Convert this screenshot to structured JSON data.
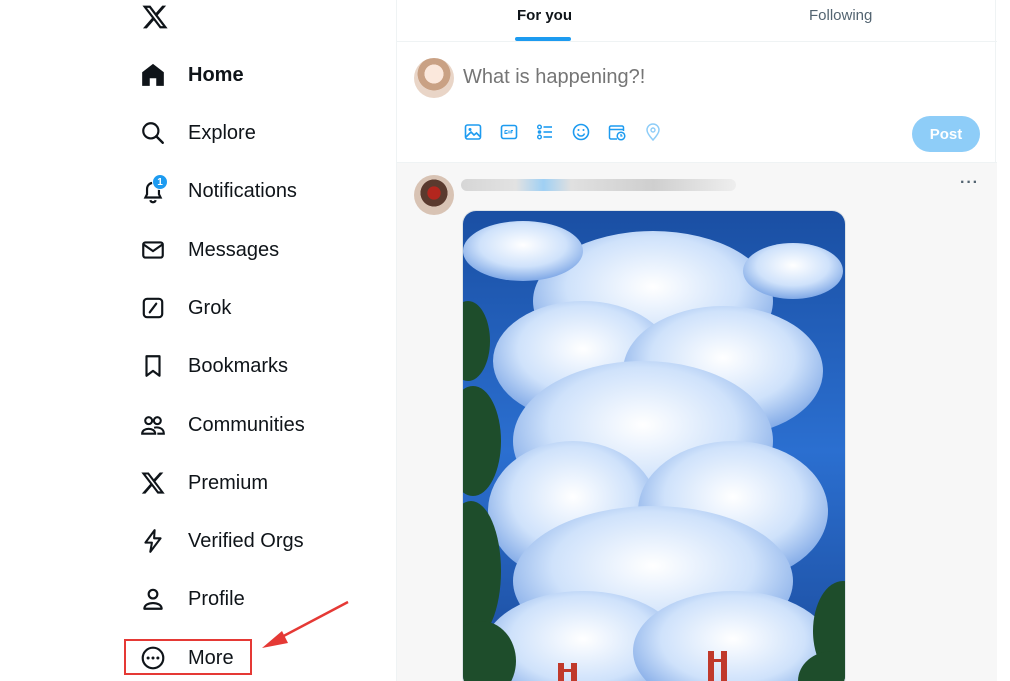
{
  "sidebar": {
    "logo": "x-logo-icon",
    "items": [
      {
        "label": "Home",
        "icon": "home-icon",
        "active": true
      },
      {
        "label": "Explore",
        "icon": "search-icon"
      },
      {
        "label": "Notifications",
        "icon": "bell-icon",
        "badge": "1"
      },
      {
        "label": "Messages",
        "icon": "envelope-icon"
      },
      {
        "label": "Grok",
        "icon": "grok-icon"
      },
      {
        "label": "Bookmarks",
        "icon": "bookmark-icon"
      },
      {
        "label": "Communities",
        "icon": "people-icon"
      },
      {
        "label": "Premium",
        "icon": "x-premium-icon"
      },
      {
        "label": "Verified Orgs",
        "icon": "lightning-icon"
      },
      {
        "label": "Profile",
        "icon": "person-icon"
      },
      {
        "label": "More",
        "icon": "more-circle-icon"
      }
    ]
  },
  "tabs": [
    {
      "label": "For you",
      "active": true
    },
    {
      "label": "Following",
      "active": false
    }
  ],
  "composer": {
    "placeholder": "What is happening?!",
    "post_label": "Post",
    "tools": [
      "image-icon",
      "gif-icon",
      "poll-icon",
      "emoji-icon",
      "schedule-icon",
      "location-icon"
    ]
  },
  "tweet": {
    "more_label": "···",
    "image_icon": "sky-clouds-bridge-image"
  },
  "colors": {
    "accent": "#1d9bf0",
    "post_disabled": "#8ecdf8",
    "annotation": "#e53935"
  }
}
